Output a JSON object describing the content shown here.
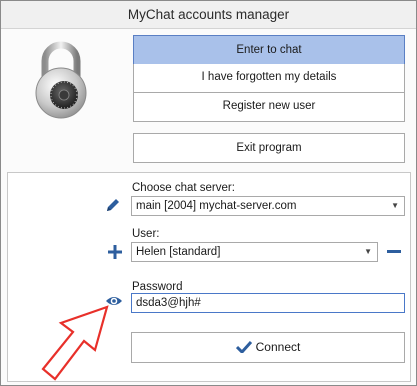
{
  "window": {
    "title": "MyChat accounts manager"
  },
  "buttons": {
    "enter_chat": "Enter to chat",
    "forgot": "I have forgotten my details",
    "register": "Register new user",
    "exit": "Exit program",
    "connect": "Connect"
  },
  "server": {
    "label": "Choose chat server:",
    "selected": "main [2004] mychat-server.com"
  },
  "user": {
    "label": "User:",
    "selected": "Helen [standard]"
  },
  "password": {
    "label": "Password",
    "value": "dsda3@hjh#"
  },
  "icons": {
    "lock": "padlock-icon",
    "pencil": "pencil-icon",
    "add": "plus-icon",
    "remove": "minus-icon",
    "eye": "eye-icon",
    "check": "checkmark-icon",
    "arrow": "red-arrow-annotation"
  },
  "colors": {
    "primary_button": "#a9c1ea",
    "icon_blue": "#2d5e9e",
    "arrow_red": "#e8302a"
  }
}
